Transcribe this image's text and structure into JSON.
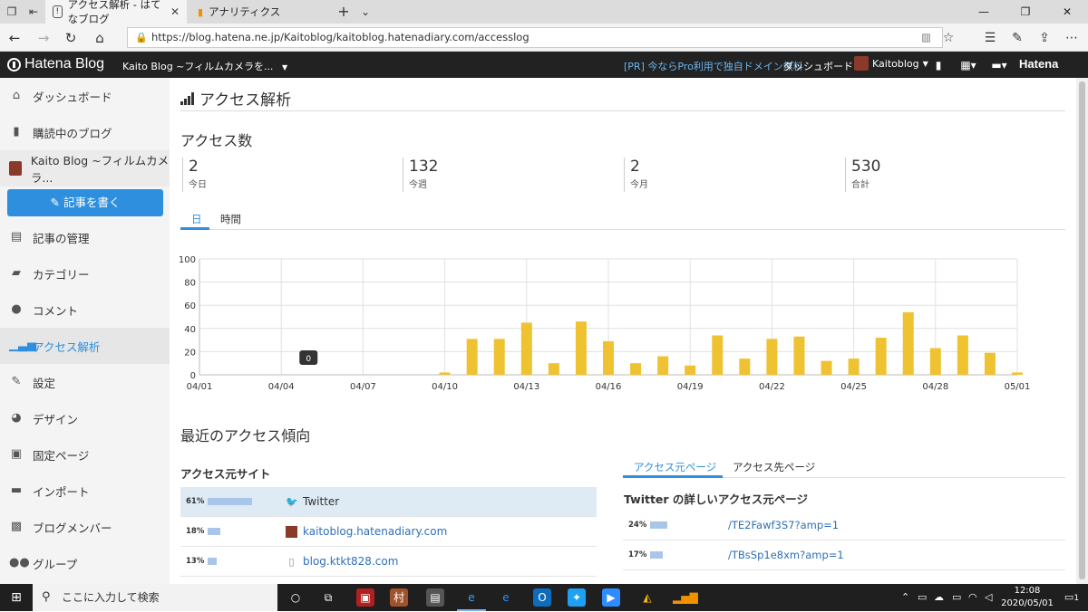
{
  "browser": {
    "tabs": [
      {
        "title": "アクセス解析 - はてなブログ"
      },
      {
        "title": "アナリティクス"
      }
    ],
    "new_tab_icon": "+",
    "url": "https://blog.hatena.ne.jp/Kaitoblog/kaitoblog.hatenadiary.com/accesslog"
  },
  "header": {
    "logo": "Hatena Blog",
    "blog_selector": "Kaito Blog ~フィルムカメラを...",
    "promo": "[PR] 今ならPro利用で独自ドメイン無料",
    "dashboard": "ダッシュボード",
    "user": "Kaitoblog",
    "brand": "Hatena"
  },
  "sidebar": {
    "items": [
      {
        "label": "ダッシュボード",
        "icon": "home-icon"
      },
      {
        "label": "購読中のブログ",
        "icon": "bookmark-icon"
      },
      {
        "label": "Kaito Blog ~フィルムカメラ...",
        "icon": "blog-avatar-icon"
      },
      {
        "label": "記事の管理",
        "icon": "document-icon"
      },
      {
        "label": "カテゴリー",
        "icon": "folder-icon"
      },
      {
        "label": "コメント",
        "icon": "comment-icon"
      },
      {
        "label": "アクセス解析",
        "icon": "bar-chart-icon"
      },
      {
        "label": "設定",
        "icon": "wrench-icon"
      },
      {
        "label": "デザイン",
        "icon": "palette-icon"
      },
      {
        "label": "固定ページ",
        "icon": "page-icon"
      },
      {
        "label": "インポート",
        "icon": "truck-icon"
      },
      {
        "label": "ブログメンバー",
        "icon": "member-icon"
      },
      {
        "label": "グループ",
        "icon": "group-icon"
      }
    ],
    "write_button": "記事を書く"
  },
  "main": {
    "page_title": "アクセス解析",
    "access_count_title": "アクセス数",
    "stats": [
      {
        "value": "2",
        "label": "今日"
      },
      {
        "value": "132",
        "label": "今週"
      },
      {
        "value": "2",
        "label": "今月"
      },
      {
        "value": "530",
        "label": "合計"
      }
    ],
    "tabs": [
      "日",
      "時間"
    ],
    "recent_title": "最近のアクセス傾向",
    "referrer_sites_title": "アクセス元サイト",
    "referrer_sites": [
      {
        "pct": "61%",
        "fraction": 0.61,
        "site": "Twitter",
        "icon": "twitter-icon"
      },
      {
        "pct": "18%",
        "fraction": 0.18,
        "site": "kaitoblog.hatenadiary.com",
        "icon": "blog-avatar-icon"
      },
      {
        "pct": "13%",
        "fraction": 0.13,
        "site": "blog.ktkt828.com",
        "icon": "page-icon"
      }
    ],
    "right_tabs": [
      "アクセス元ページ",
      "アクセス先ページ"
    ],
    "twitter_detail_title": "Twitter の詳しいアクセス元ページ",
    "twitter_pages": [
      {
        "pct": "24%",
        "fraction": 0.24,
        "path": "/TE2Fawf3S7?amp=1"
      },
      {
        "pct": "17%",
        "fraction": 0.17,
        "path": "/TBsSp1e8xm?amp=1"
      }
    ]
  },
  "chart_data": {
    "type": "bar",
    "categories": [
      "04/01",
      "04/02",
      "04/03",
      "04/04",
      "04/05",
      "04/06",
      "04/07",
      "04/08",
      "04/09",
      "04/10",
      "04/11",
      "04/12",
      "04/13",
      "04/14",
      "04/15",
      "04/16",
      "04/17",
      "04/18",
      "04/19",
      "04/20",
      "04/21",
      "04/22",
      "04/23",
      "04/24",
      "04/25",
      "04/26",
      "04/27",
      "04/28",
      "04/29",
      "04/30",
      "05/01"
    ],
    "values": [
      0,
      0,
      0,
      0,
      0,
      0,
      0,
      0,
      0,
      2,
      31,
      31,
      45,
      10,
      46,
      29,
      10,
      16,
      8,
      34,
      14,
      31,
      33,
      12,
      14,
      32,
      54,
      23,
      34,
      19,
      2
    ],
    "tick_labels": [
      "04/01",
      "04/04",
      "04/07",
      "04/10",
      "04/13",
      "04/16",
      "04/19",
      "04/22",
      "04/25",
      "04/28",
      "05/01"
    ],
    "ylim": [
      0,
      100
    ],
    "y_ticks": [
      0,
      20,
      40,
      60,
      80,
      100
    ],
    "tooltip": {
      "category": "04/05",
      "text": "0"
    },
    "bar_color": "#efc232",
    "grid": true
  },
  "taskbar": {
    "search_placeholder": "ここに入力して検索",
    "time": "12:08",
    "date": "2020/05/01",
    "notification_count": "1"
  }
}
